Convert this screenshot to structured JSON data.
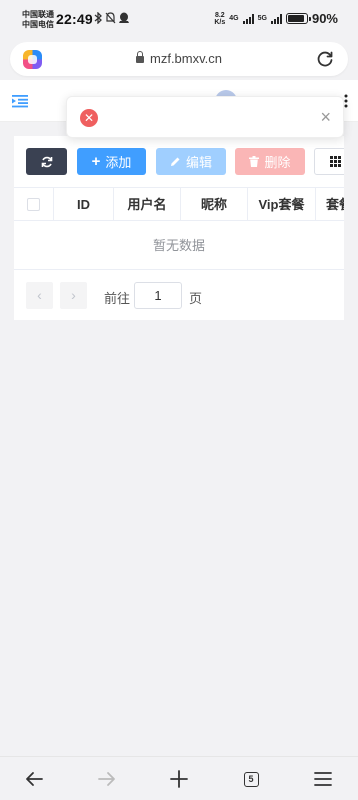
{
  "status_bar": {
    "carrier_1": "中国联通",
    "carrier_2": "中国电信",
    "time": "22:49",
    "net_speed_value": "8.2",
    "net_speed_unit": "K/s",
    "network_1": "4G",
    "network_2": "5G",
    "battery": "90%",
    "battery_level": 0.9
  },
  "address_bar": {
    "url": "mzf.bmxv.cn"
  },
  "toast": {
    "type": "error",
    "message": ""
  },
  "toolbar": {
    "add_label": "添加",
    "edit_label": "编辑",
    "delete_label": "删除"
  },
  "table": {
    "columns": [
      "ID",
      "用户名",
      "昵称",
      "Vip套餐",
      "套餐"
    ],
    "empty_text": "暂无数据"
  },
  "pagination": {
    "goto_label": "前往",
    "page_value": "1",
    "page_suffix": "页"
  },
  "bottom_nav": {
    "tab_count": "5"
  },
  "colors": {
    "primary": "#409eff",
    "primary_disabled": "#a0cfff",
    "danger_disabled": "#fab6b6",
    "dark_button": "#3a4152",
    "error": "#ef5f5f"
  }
}
